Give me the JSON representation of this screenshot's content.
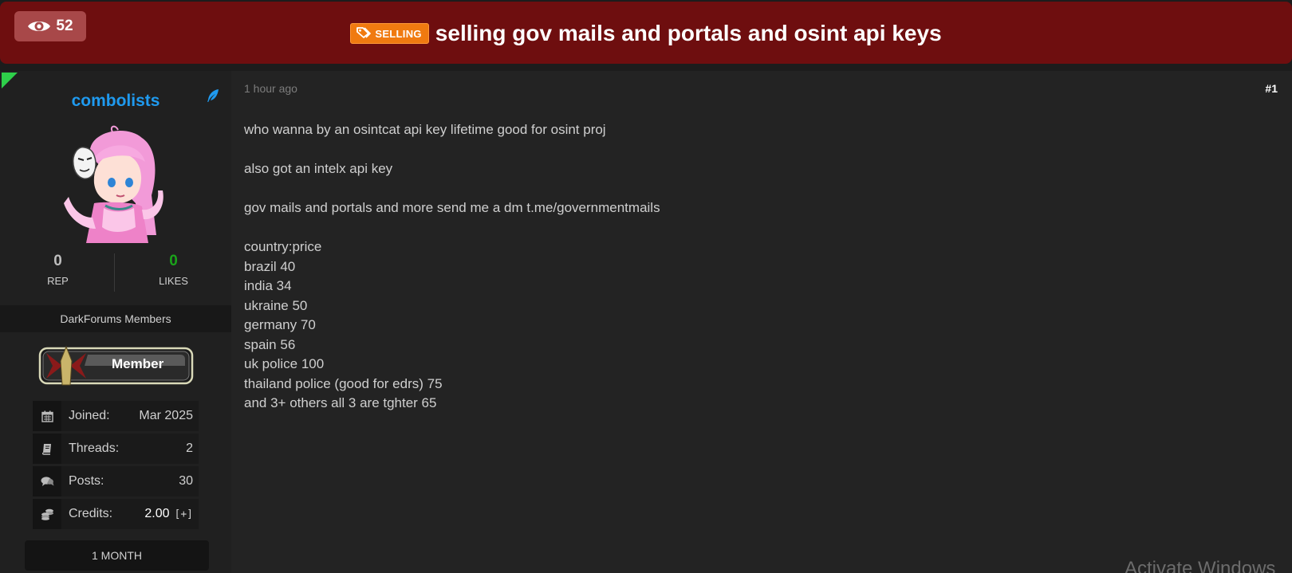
{
  "header": {
    "views": "52",
    "prefix_label": "SELLING",
    "title": "selling gov mails and portals and osint api keys",
    "bg_color": "#6e0e0f",
    "prefix_color": "#f07a10",
    "icons": {
      "views": "eye-icon",
      "prefix": "tag-icon"
    }
  },
  "author": {
    "username": "combolists",
    "username_color": "#1f9aef",
    "rep_value": "0",
    "rep_label": "REP",
    "likes_value": "0",
    "likes_label": "LIKES",
    "group": "DarkForums Members",
    "badge_label": "Member",
    "info": [
      {
        "icon": "calendar-icon",
        "label": "Joined:",
        "value": "Mar 2025"
      },
      {
        "icon": "book-icon",
        "label": "Threads:",
        "value": "2"
      },
      {
        "icon": "comments-icon",
        "label": "Posts:",
        "value": "30"
      },
      {
        "icon": "coins-icon",
        "label": "Credits:",
        "value": "2.00",
        "extra": "[+]"
      }
    ],
    "membership": "1 MONTH"
  },
  "post": {
    "time": "1 hour ago",
    "number": "#1",
    "body": "who wanna by an osintcat api key lifetime good for osint proj\n\nalso got an intelx api key\n\ngov mails and portals and more send me a dm t.me/governmentmails\n\ncountry:price\nbrazil 40\nindia 34\nukraine 50\ngermany 70\nspain 56\nuk police 100\nthailand police (good for edrs)  75\nand 3+ others  all 3 are tghter 65"
  },
  "overlay": {
    "watermark": "Activate Windows"
  }
}
